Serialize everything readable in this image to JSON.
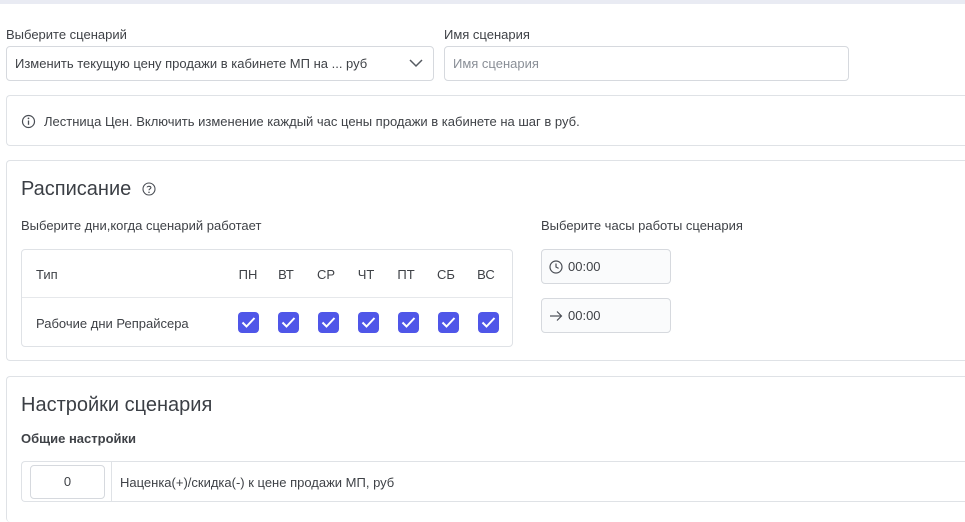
{
  "scenario": {
    "select_label": "Выберите сценарий",
    "select_value": "Изменить текущую цену продажи в кабинете МП на ... руб",
    "name_label": "Имя сценария",
    "name_placeholder": "Имя сценария",
    "name_value": ""
  },
  "info": {
    "icon": "info-icon",
    "text": "Лестница Цен. Включить изменение каждый час цены продажи в кабинете на шаг в руб."
  },
  "schedule": {
    "title": "Расписание",
    "help_icon": "question-circle-icon",
    "days_label": "Выберите дни,когда сценарий работает",
    "hours_label": "Выберите часы работы сценария",
    "table": {
      "type_header": "Тип",
      "days": [
        "ПН",
        "ВТ",
        "СР",
        "ЧТ",
        "ПТ",
        "СБ",
        "ВС"
      ],
      "row_label": "Рабочие дни Репрайсера",
      "checked": [
        true,
        true,
        true,
        true,
        true,
        true,
        true
      ]
    },
    "time_from": "00:00",
    "time_to": "00:00",
    "accent_color": "#4f56e8"
  },
  "settings": {
    "title": "Настройки сценария",
    "general_label": "Общие настройки",
    "markup_value": "0",
    "markup_label": "Наценка(+)/скидка(-) к цене продажи МП, руб"
  }
}
